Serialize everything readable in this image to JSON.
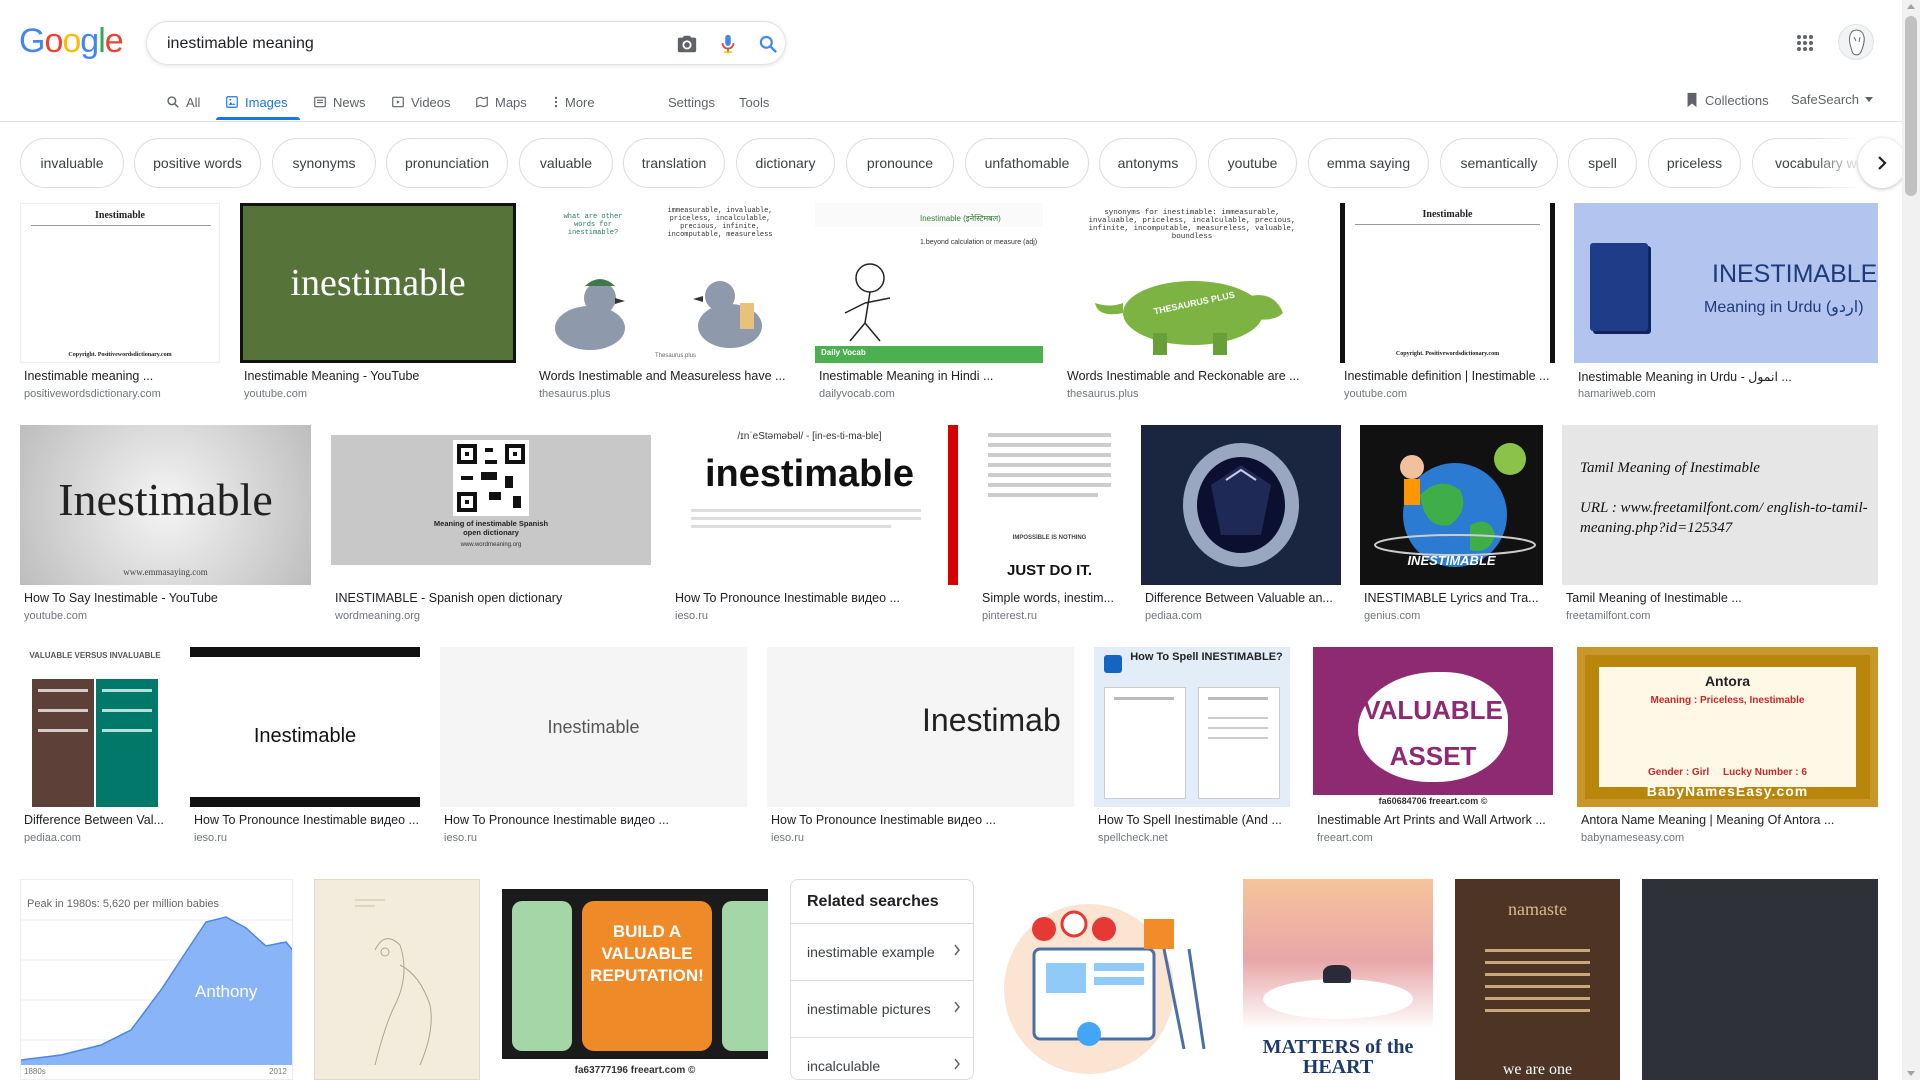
{
  "logo": {
    "letters": [
      "G",
      "o",
      "o",
      "g",
      "l",
      "e"
    ],
    "colors": [
      "#4285F4",
      "#EA4335",
      "#FBBC05",
      "#4285F4",
      "#34A853",
      "#EA4335"
    ]
  },
  "search": {
    "query": "inestimable meaning",
    "camera_icon": "camera-icon",
    "mic_icon": "mic-icon",
    "search_icon": "search-icon"
  },
  "nav": {
    "all": "All",
    "images": "Images",
    "news": "News",
    "videos": "Videos",
    "maps": "Maps",
    "more": "More",
    "settings": "Settings",
    "tools": "Tools",
    "collections": "Collections",
    "safesearch": "SafeSearch"
  },
  "chips": [
    "invaluable",
    "positive words",
    "synonyms",
    "pronunciation",
    "valuable",
    "translation",
    "dictionary",
    "pronounce",
    "unfathomable",
    "antonyms",
    "youtube",
    "emma saying",
    "semantically",
    "spell",
    "priceless",
    "vocabulary wo"
  ],
  "results": [
    {
      "title": "Inestimable meaning ...",
      "source": "positivewordsdictionary.com"
    },
    {
      "title": "Inestimable Meaning - YouTube",
      "source": "youtube.com",
      "thumb_text": "inestimable"
    },
    {
      "title": "Words Inestimable and Measureless have ...",
      "source": "thesaurus.plus"
    },
    {
      "title": "Inestimable Meaning in Hindi ...",
      "source": "dailyvocab.com"
    },
    {
      "title": "Words Inestimable and Reckonable are ...",
      "source": "thesaurus.plus"
    },
    {
      "title": "Inestimable definition | Inestimable ...",
      "source": "youtube.com"
    },
    {
      "title": "Inestimable Meaning in Urdu - انمول ...",
      "source": "hamariweb.com",
      "thumb_text": "INESTIMABLE",
      "thumb_sub": "Meaning in Urdu (اردو)"
    },
    {
      "title": "How To Say Inestimable - YouTube",
      "source": "youtube.com",
      "thumb_text": "Inestimable",
      "thumb_sub": "www.emmasaying.com"
    },
    {
      "title": "INESTIMABLE - Spanish open dictionary",
      "source": "wordmeaning.org",
      "thumb_text": "Meaning of inestimable Spanish open dictionary",
      "thumb_sub": "www.wordmeaning.org"
    },
    {
      "title": "How To Pronounce Inestimable видео ...",
      "source": "ieso.ru",
      "thumb_text": "inestimable",
      "thumb_sub": "/ɪnˈeStəməbəl/ - [in-es-ti-ma-ble]"
    },
    {
      "title": "Simple words, inestim...",
      "source": "pinterest.ru",
      "thumb_text": "JUST DO IT.",
      "thumb_sub": "IMPOSSIBLE IS NOTHING"
    },
    {
      "title": "Difference Between Valuable an...",
      "source": "pediaa.com"
    },
    {
      "title": "INESTIMABLE Lyrics and Tra...",
      "source": "genius.com",
      "thumb_text": "INESTIMABLE"
    },
    {
      "title": "Tamil Meaning of Inestimable ...",
      "source": "freetamilfont.com",
      "thumb_text": "Tamil Meaning of Inestimable",
      "thumb_sub": "URL : www.freetamilfont.com/ english-to-tamil-meaning.php?id=125347"
    },
    {
      "title": "Difference Between Val...",
      "source": "pediaa.com",
      "thumb_text": "VALUABLE VERSUS INVALUABLE"
    },
    {
      "title": "How To Pronounce Inestimable видео ...",
      "source": "ieso.ru",
      "thumb_text": "Inestimable"
    },
    {
      "title": "How To Pronounce Inestimable видео ...",
      "source": "ieso.ru",
      "thumb_text": "Inestimable"
    },
    {
      "title": "How To Pronounce Inestimable видео ...",
      "source": "ieso.ru",
      "thumb_text": "Inestimab"
    },
    {
      "title": "How To Spell Inestimable (And ...",
      "source": "spellcheck.net",
      "thumb_text": "How To Spell INESTIMABLE?"
    },
    {
      "title": "Inestimable Art Prints and Wall Artwork ...",
      "source": "freeart.com",
      "thumb_text": "VALUABLE ASSET",
      "thumb_sub": "fa60684706 freeart.com ©"
    },
    {
      "title": "Antora Name Meaning | Meaning Of Antora ...",
      "source": "babynameseasy.com",
      "thumb_text": "Antora",
      "thumb_sub": "Meaning : Priceless, Inestimable",
      "thumb_extra": "Gender : Girl     Lucky Number : 6",
      "thumb_brand": "BabyNamesEasy.com"
    },
    {
      "thumb_text": "Peak in 1980s: 5,620 per million babies",
      "thumb_sub": "Anthony",
      "axis_start": "1880s",
      "axis_end": "2012"
    },
    {},
    {
      "thumb_text": "BUILD A VALUABLE REPUTATION!",
      "thumb_sub": "fa63777196 freeart.com ©"
    },
    {},
    {
      "thumb_text": "MATTERS of the HEART"
    },
    {
      "thumb_text": "namaste",
      "thumb_sub": "we are one"
    },
    {}
  ],
  "related": {
    "title": "Related searches",
    "items": [
      "inestimable example",
      "inestimable pictures",
      "incalculable"
    ]
  },
  "thumb_misc": {
    "r0_title": "Inestimable",
    "r0_foot": "Copyright. Positivewordsdictionary.com",
    "r2_q": "what are other words for inestimable?",
    "r2_list": "immeasurable, invaluable, priceless, incalculable, precious, infinite, incomputable, measureless",
    "r3_head": "Inestimable (इनेस्टिमबल)",
    "r3_def": "1.beyond calculation or measure (adj)",
    "r4_list": "synonyms for inestimable: immeasurable, invaluable, priceless, incalculable, precious, infinite, incomputable, measureless, valuable, boundless",
    "r4_brand": "THESAURUS PLUS",
    "r3_brand": "Daily Vocab"
  }
}
